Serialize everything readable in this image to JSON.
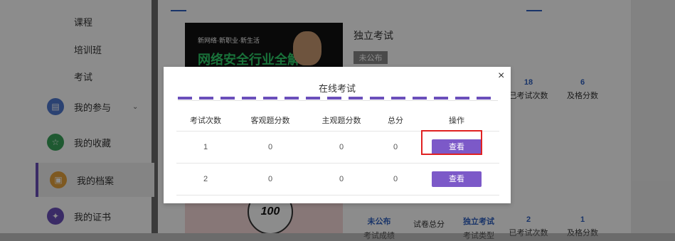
{
  "sidebar": {
    "sub_items": [
      "课程",
      "培训班",
      "考试"
    ],
    "items": [
      {
        "label": "我的参与",
        "icon": "document-icon",
        "color": "#4f78d0",
        "chevron": "⌄"
      },
      {
        "label": "我的收藏",
        "icon": "star-icon",
        "color": "#3aa35a"
      },
      {
        "label": "我的档案",
        "icon": "briefcase-icon",
        "color": "#e6a23c",
        "active": true
      },
      {
        "label": "我的证书",
        "icon": "certificate-icon",
        "color": "#6b4fbb"
      }
    ]
  },
  "course": {
    "thumb_top": "新网络·新职业·新生活",
    "thumb_title": "网络安全行业全解析",
    "title": "独立考试",
    "badge": "未公布",
    "stats_top": [
      {
        "value": "18",
        "label": "已考试次数"
      },
      {
        "value": "6",
        "label": "及格分数"
      }
    ],
    "stats_bottom": [
      {
        "value": "未公布",
        "label": "考试成绩"
      },
      {
        "value": "",
        "label": "试卷总分"
      },
      {
        "value": "独立考试",
        "label": "考试类型"
      },
      {
        "value": "2",
        "label": "已考试次数"
      },
      {
        "value": "1",
        "label": "及格分数"
      }
    ],
    "badge100": "100"
  },
  "modal": {
    "title": "在线考试",
    "close": "×",
    "columns": [
      "考试次数",
      "客观题分数",
      "主观题分数",
      "总分",
      "操作"
    ],
    "rows": [
      {
        "attempt": "1",
        "objective": "0",
        "subjective": "0",
        "total": "0",
        "action": "查看"
      },
      {
        "attempt": "2",
        "objective": "0",
        "subjective": "0",
        "total": "0",
        "action": "查看"
      }
    ]
  },
  "colors": {
    "accent": "#7c59c8",
    "highlight": "#e02222",
    "stat_value": "#2e5fbf"
  }
}
